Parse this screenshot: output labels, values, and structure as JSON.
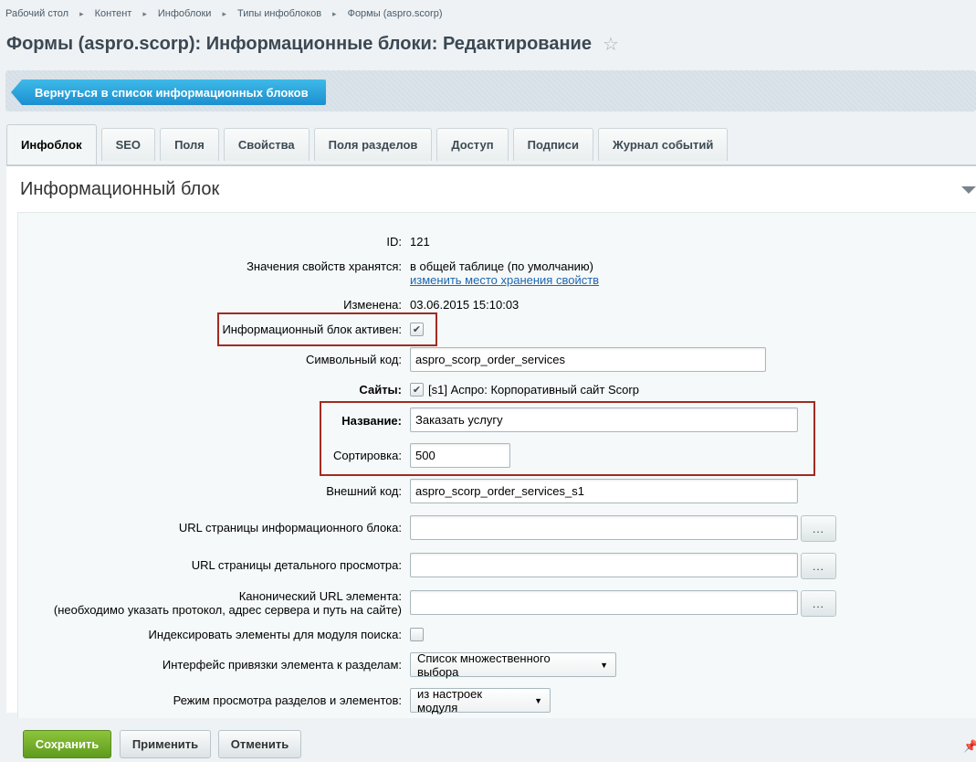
{
  "breadcrumb": [
    "Рабочий стол",
    "Контент",
    "Инфоблоки",
    "Типы инфоблоков",
    "Формы (aspro.scorp)"
  ],
  "page_title": "Формы (aspro.scorp): Информационные блоки: Редактирование",
  "back_button_label": "Вернуться в список информационных блоков",
  "tabs": [
    {
      "label": "Инфоблок",
      "active": true
    },
    {
      "label": "SEO"
    },
    {
      "label": "Поля"
    },
    {
      "label": "Свойства"
    },
    {
      "label": "Поля разделов"
    },
    {
      "label": "Доступ"
    },
    {
      "label": "Подписи"
    },
    {
      "label": "Журнал событий"
    }
  ],
  "section_title": "Информационный блок",
  "form": {
    "id": {
      "label": "ID:",
      "value": "121"
    },
    "storage": {
      "label": "Значения свойств хранятся:",
      "value": "в общей таблице (по умолчанию)",
      "link": "изменить место хранения свойств"
    },
    "modified": {
      "label": "Изменена:",
      "value": "03.06.2015 15:10:03"
    },
    "active": {
      "label": "Информационный блок активен:",
      "checked": true
    },
    "code": {
      "label": "Символьный код:",
      "value": "aspro_scorp_order_services"
    },
    "sites": {
      "label": "Сайты:",
      "value": "[s1] Аспро: Корпоративный сайт Scorp",
      "checked": true
    },
    "name": {
      "label": "Название:",
      "value": "Заказать услугу"
    },
    "sort": {
      "label": "Сортировка:",
      "value": "500"
    },
    "external_code": {
      "label": "Внешний код:",
      "value": "aspro_scorp_order_services_s1"
    },
    "list_url": {
      "label": "URL страницы информационного блока:",
      "value": ""
    },
    "detail_url": {
      "label": "URL страницы детального просмотра:",
      "value": ""
    },
    "canonical_url": {
      "label": "Канонический URL элемента:",
      "note": "(необходимо указать протокол, адрес сервера и путь на сайте)",
      "value": ""
    },
    "index_search": {
      "label": "Индексировать элементы для модуля поиска:",
      "checked": false
    },
    "section_binding": {
      "label": "Интерфейс привязки элемента к разделам:",
      "value": "Список множественного выбора"
    },
    "view_mode": {
      "label": "Режим просмотра разделов и элементов:",
      "value": "из настроек модуля"
    },
    "dots_label": "..."
  },
  "buttons": {
    "save": "Сохранить",
    "apply": "Применить",
    "cancel": "Отменить"
  },
  "icons": {
    "star": "star-icon",
    "pin": "pin-icon",
    "checkmark": "check-icon"
  },
  "colors": {
    "accent_blue": "#1c8fd0",
    "save_green": "#6aa829",
    "highlight_red": "#a12b22",
    "link": "#2067b0"
  }
}
